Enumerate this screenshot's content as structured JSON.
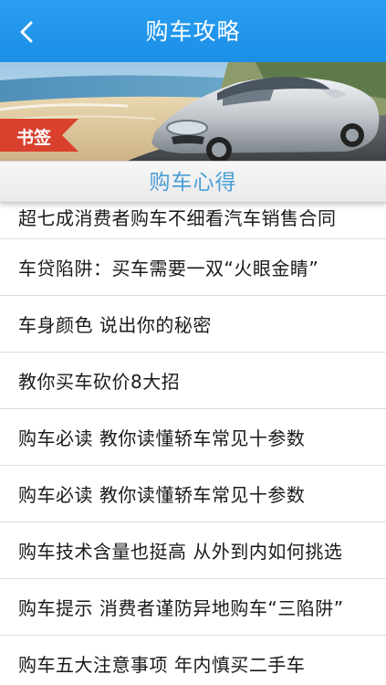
{
  "header": {
    "title": "购车攻略",
    "back_icon": "chevron-left-icon",
    "color": "#2196f0"
  },
  "banner": {
    "tag_label": "书签",
    "tag_color": "#d9412e"
  },
  "section": {
    "title": "购车心得"
  },
  "articles": [
    {
      "title": "超七成消费者购车不细看汽车销售合同"
    },
    {
      "title": "车贷陷阱：买车需要一双“火眼金睛”"
    },
    {
      "title": "车身颜色 说出你的秘密"
    },
    {
      "title": "教你买车砍价8大招"
    },
    {
      "title": "购车必读 教你读懂轿车常见十参数"
    },
    {
      "title": "购车必读 教你读懂轿车常见十参数"
    },
    {
      "title": "购车技术含量也挺高 从外到内如何挑选"
    },
    {
      "title": "购车提示 消费者谨防异地购车“三陷阱”"
    },
    {
      "title": "购车五大注意事项 年内慎买二手车"
    }
  ]
}
